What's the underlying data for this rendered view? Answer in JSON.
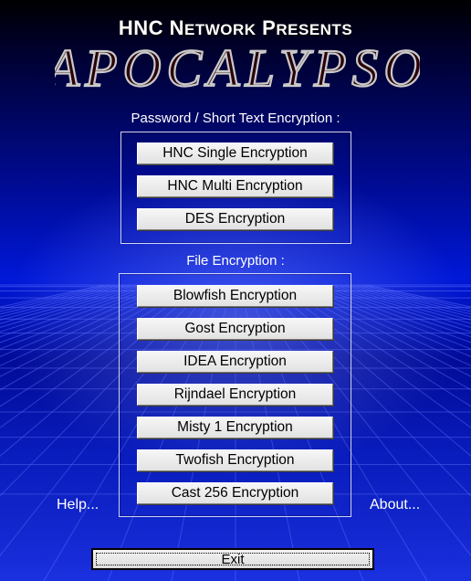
{
  "header": {
    "presents_prefix": "HNC N",
    "presents_etwork": "ETWORK",
    "presents_p": " P",
    "presents_resents": "RESENTS",
    "logo": "APOCALYPSO"
  },
  "password_section": {
    "label": "Password / Short Text Encryption :",
    "buttons": [
      "HNC Single Encryption",
      "HNC Multi Encryption",
      "DES Encryption"
    ]
  },
  "file_section": {
    "label": "File Encryption :",
    "buttons": [
      "Blowfish Encryption",
      "Gost Encryption",
      "IDEA Encryption",
      "Rijndael Encryption",
      "Misty 1 Encryption",
      "Twofish Encryption",
      "Cast 256 Encryption"
    ]
  },
  "links": {
    "help": "Help...",
    "about": "About..."
  },
  "exit_label": "Exit",
  "colors": {
    "background": "#0018d8",
    "logo_fill": "#2a0008",
    "logo_stroke": "#c8c8c8"
  }
}
